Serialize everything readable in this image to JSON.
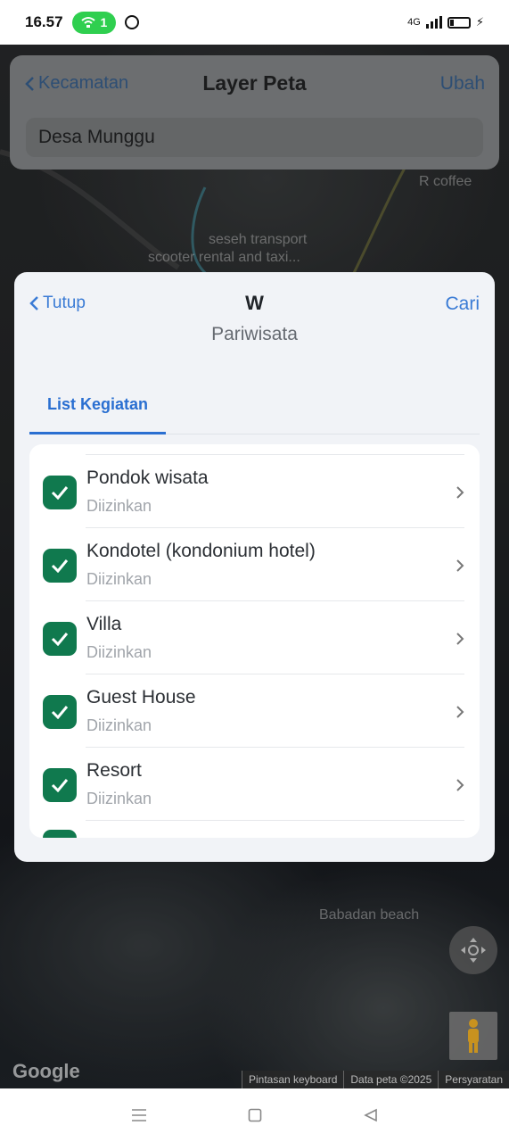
{
  "status_bar": {
    "time": "16.57",
    "hotspot_count": "1",
    "network": "4G"
  },
  "map": {
    "labels": {
      "cafe": "R coffee",
      "transport": "seseh transport",
      "transport2": "scooter rental and taxi...",
      "beach": "Babadan beach"
    },
    "logo": "Google",
    "footer": {
      "keyboard": "Pintasan keyboard",
      "data": "Data peta ©2025",
      "terms": "Persyaratan"
    }
  },
  "top_card": {
    "back_label": "Kecamatan",
    "title": "Layer Peta",
    "edit_label": "Ubah",
    "field_value": "Desa Munggu"
  },
  "sheet": {
    "close_label": "Tutup",
    "title": "W",
    "subtitle": "Pariwisata",
    "search_label": "Cari",
    "tabs": [
      {
        "label": "List Kegiatan",
        "active": true
      }
    ],
    "items": [
      {
        "label": "Pondok wisata",
        "status": "Diizinkan",
        "checked": true
      },
      {
        "label": "Kondotel (kondonium hotel)",
        "status": "Diizinkan",
        "checked": true
      },
      {
        "label": "Villa",
        "status": "Diizinkan",
        "checked": true
      },
      {
        "label": "Guest House",
        "status": "Diizinkan",
        "checked": true
      },
      {
        "label": "Resort",
        "status": "Diizinkan",
        "checked": true
      }
    ]
  },
  "colors": {
    "accent_blue": "#3a7bd5",
    "check_green": "#10794e",
    "status_hotspot_green": "#2fcf4f"
  }
}
